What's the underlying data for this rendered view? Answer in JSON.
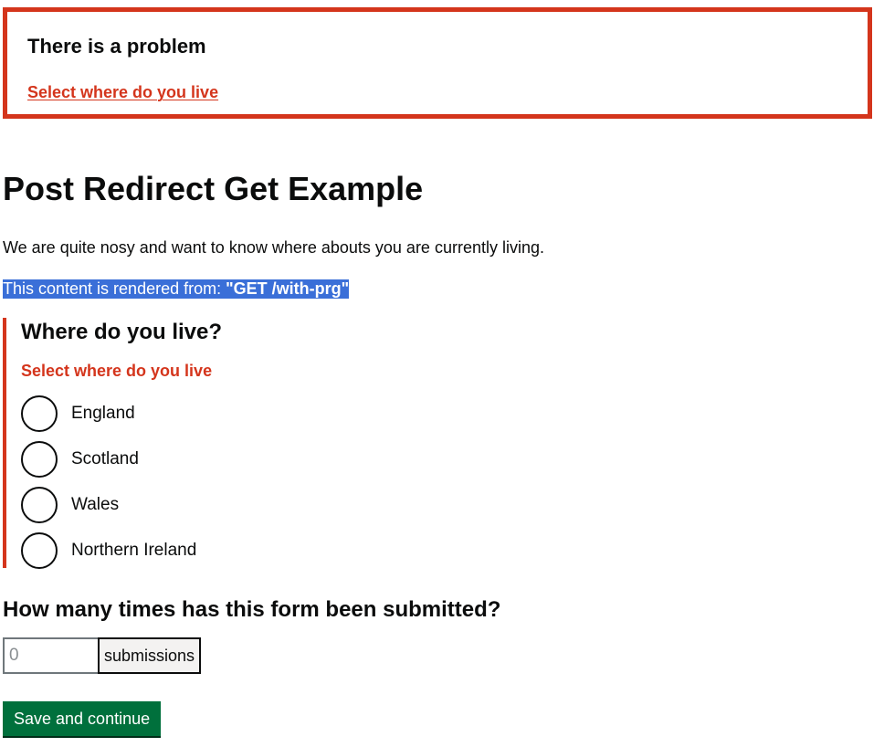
{
  "error_summary": {
    "title": "There is a problem",
    "link_text": "Select where do you live"
  },
  "page": {
    "title": "Post Redirect Get Example",
    "intro": "We are quite nosy and want to know where abouts you are currently living.",
    "render_note_prefix": "This content is rendered from: ",
    "render_note_route": "\"GET /with-prg\""
  },
  "residence_question": {
    "legend": "Where do you live?",
    "error_message": "Select where do you live",
    "options": [
      {
        "label": "England",
        "selected": false
      },
      {
        "label": "Scotland",
        "selected": false
      },
      {
        "label": "Wales",
        "selected": false
      },
      {
        "label": "Northern Ireland",
        "selected": false
      }
    ]
  },
  "submissions_question": {
    "heading": "How many times has this form been submitted?",
    "placeholder": "0",
    "value": "",
    "suffix": "submissions"
  },
  "actions": {
    "submit_label": "Save and continue"
  },
  "colors": {
    "error": "#d4351c",
    "button": "#00703c",
    "highlight": "#3a6fd8",
    "text": "#0b0c0c"
  }
}
